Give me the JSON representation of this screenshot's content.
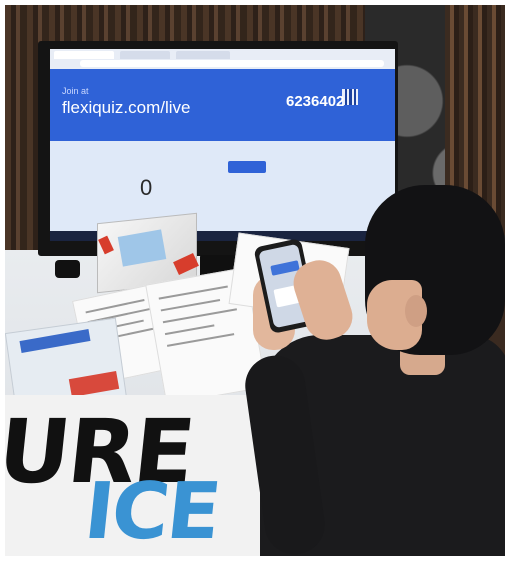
{
  "screen": {
    "join_label": "Join at",
    "join_url": "flexiquiz.com/live",
    "pin": "6236402",
    "players_count": "0"
  },
  "banner": {
    "line1": "URE",
    "line2": "ICE"
  },
  "colors": {
    "screen_blue": "#2f62d7",
    "banner_blue": "#3a93d3",
    "accent_red": "#d73d2c"
  }
}
